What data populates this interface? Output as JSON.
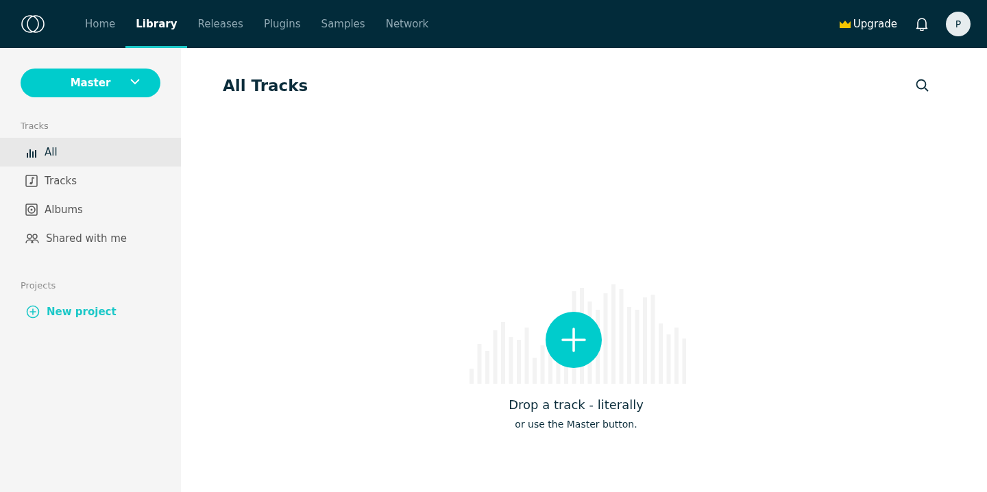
{
  "nav": {
    "tabs": [
      {
        "label": "Home",
        "selected": false
      },
      {
        "label": "Library",
        "selected": true
      },
      {
        "label": "Releases",
        "selected": false
      },
      {
        "label": "Plugins",
        "selected": false
      },
      {
        "label": "Samples",
        "selected": false
      },
      {
        "label": "Network",
        "selected": false
      }
    ],
    "upgrade": "Upgrade",
    "avatar": "P"
  },
  "sidebar": {
    "master_button": "Master",
    "sections": [
      {
        "heading": "Tracks",
        "items": [
          {
            "label": "All",
            "kind": "bars",
            "selected": true
          },
          {
            "label": "Tracks",
            "kind": "note",
            "selected": false
          },
          {
            "label": "Albums",
            "kind": "disc",
            "selected": false
          },
          {
            "label": "Shared with me",
            "kind": "people",
            "selected": false
          }
        ]
      },
      {
        "heading": "Projects",
        "items": [
          {
            "label": "New project",
            "kind": "add",
            "selected": false
          }
        ]
      }
    ]
  },
  "main": {
    "title": "All Tracks",
    "empty_title": "Drop a track - literally",
    "empty_hint": "or use the Master button."
  }
}
